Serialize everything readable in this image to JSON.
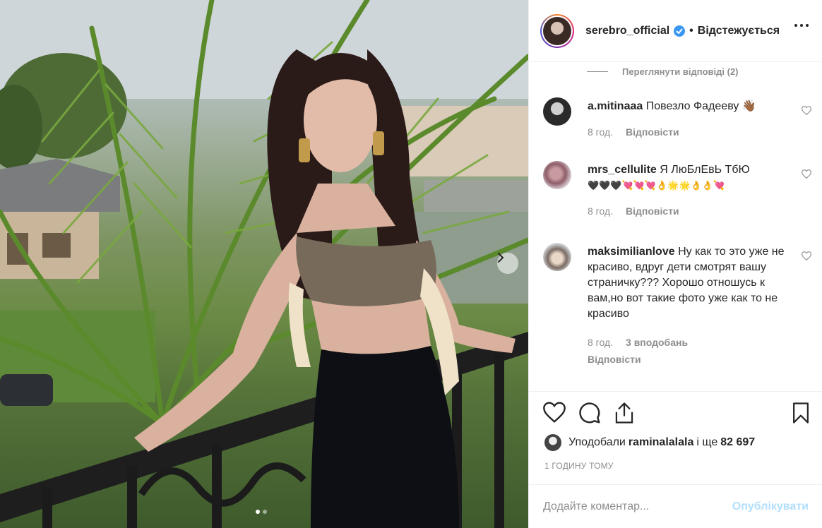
{
  "colors": {
    "accent": "#3897f0",
    "text": "#262626",
    "muted": "#8e8e8e",
    "publish_disabled": "#b2dffc"
  },
  "post": {
    "image_alt": "",
    "carousel": {
      "next_icon": "chevron-right-icon",
      "total": 2,
      "current": 1
    }
  },
  "header": {
    "username": "serebro_official",
    "separator": "•",
    "follow_status": "Відстежується",
    "verified_icon": "verified-badge-icon",
    "more_icon": "more-options-icon"
  },
  "replies": {
    "label": "Переглянути відповіді (2)"
  },
  "comments": [
    {
      "username": "a.mitinaaa",
      "text": "Повезло Фадееву 👋🏾",
      "time": "8 год.",
      "likes": "",
      "reply": "Відповісти"
    },
    {
      "username": "mrs_cellulite",
      "text": "Я ЛюБлЕвЬ ТбЮ",
      "emoji_line": "🖤🖤🖤💘💘💘👌🌟🌟👌👌💘",
      "time": "8 год.",
      "likes": "",
      "reply": "Відповісти"
    },
    {
      "username": "maksimilianlove",
      "text": "Ну как то это уже не красиво, вдруг дети смотрят вашу страничку??? Хорошо отношусь к вам,но вот такие фото уже как то не красиво",
      "time": "8 год.",
      "likes": "3 вподобань",
      "reply": "Відповісти"
    }
  ],
  "actions": {
    "like_icon": "heart-icon",
    "comment_icon": "comment-icon",
    "share_icon": "share-icon",
    "save_icon": "bookmark-icon"
  },
  "likes": {
    "prefix": "Уподобали",
    "user": "raminalalala",
    "connector": "і ще",
    "count": "82 697"
  },
  "timestamp": "1 ГОДИНУ ТОМУ",
  "add_comment": {
    "placeholder": "Додайте коментар...",
    "publish_label": "Опублікувати"
  }
}
